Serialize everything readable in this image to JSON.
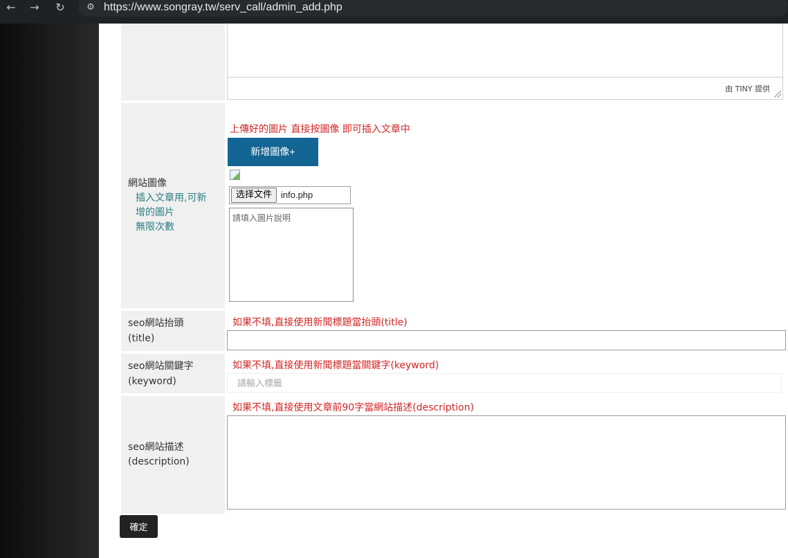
{
  "browser": {
    "url": "https://www.songray.tw/serv_call/admin_add.php",
    "back_icon": "←",
    "forward_icon": "→",
    "reload_icon": "↻",
    "site_info_icon": "⚙"
  },
  "editor": {
    "credit": "由 TINY 提供"
  },
  "image_section": {
    "label": "網站圖像",
    "sub_line1": "插入文章用,可新",
    "sub_line2": "增的圖片",
    "sub_line3": "無限次數",
    "hint": "上傳好的圖片 直接按圖像 即可插入文章中",
    "add_button": "新增圖像+",
    "choose_file": "选择文件",
    "file_name": "info.php",
    "desc_placeholder": "請填入圖片說明"
  },
  "seo_title": {
    "label_line1": "seo網站抬頭",
    "label_line2": "(title)",
    "hint": "如果不填,直接使用新聞標題當抬頭(title)"
  },
  "seo_keyword": {
    "label_line1": "seo網站關鍵字",
    "label_line2": "(keyword)",
    "hint": "如果不填,直接使用新聞標題當關鍵字(keyword)",
    "placeholder": "請輸入標籤"
  },
  "seo_description": {
    "label_line1": "seo網站描述",
    "label_line2": "(description)",
    "hint": "如果不填,直接使用文章前90字當網站描述(description)"
  },
  "submit_label": "確定",
  "colors": {
    "accent_button": "#136593",
    "hint_red": "#d32626",
    "sub_label_teal": "#2c7f84"
  }
}
